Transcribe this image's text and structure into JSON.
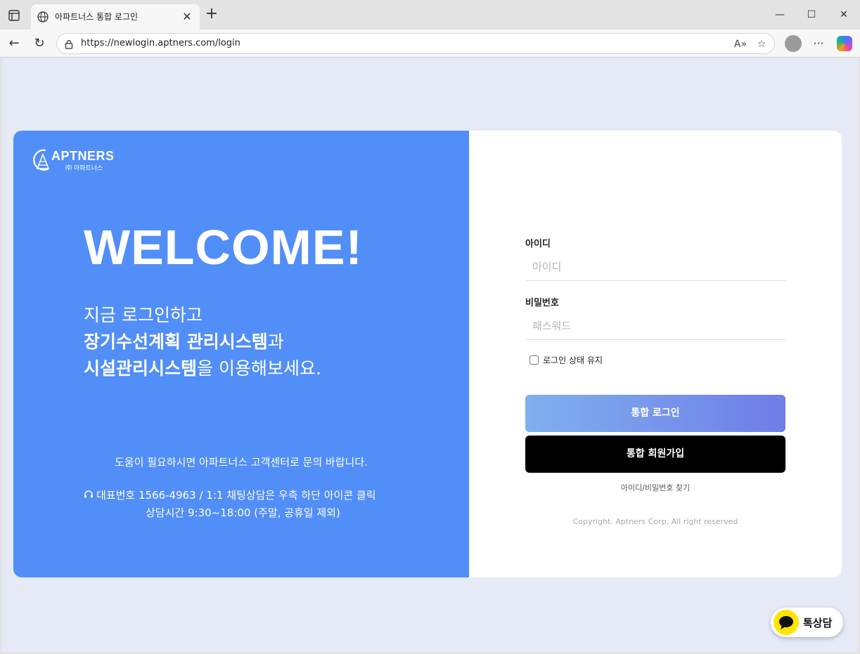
{
  "browser": {
    "tab_title": "아파트너스 통합 로그인",
    "url": "https://newlogin.aptners.com/login"
  },
  "brand": {
    "name": "APTNERS",
    "sub": "㈜ 아파트너스",
    "primary_color": "#518ef8"
  },
  "hero": {
    "welcome": "WELCOME!",
    "line1": "지금 로그인하고",
    "line2_bold": "장기수선계획 관리시스템",
    "line2_rest": "과",
    "line3_bold": "시설관리시스템",
    "line3_rest": "을 이용해보세요."
  },
  "help": {
    "line1": "도움이 필요하시면 아파트너스 고객센터로 문의 바랍니다.",
    "line2": "대표번호 1566-4963 / 1:1 채팅상담은 우측 하단 아이콘 클릭",
    "line3": "상담시간 9:30~18:00 (주말, 공휴일 제외)"
  },
  "form": {
    "id_label": "아이디",
    "id_placeholder": "아이디",
    "pw_label": "비밀번호",
    "pw_placeholder": "패스워드",
    "remember_label": "로그인 상태 유지",
    "login_button": "통합 로그인",
    "signup_button": "통합 회원가입",
    "find_link": "아이디/비밀번호 찾기",
    "copyright": "Copyright. Aptners Corp. All right reserved"
  },
  "chat": {
    "label": "톡상담"
  }
}
